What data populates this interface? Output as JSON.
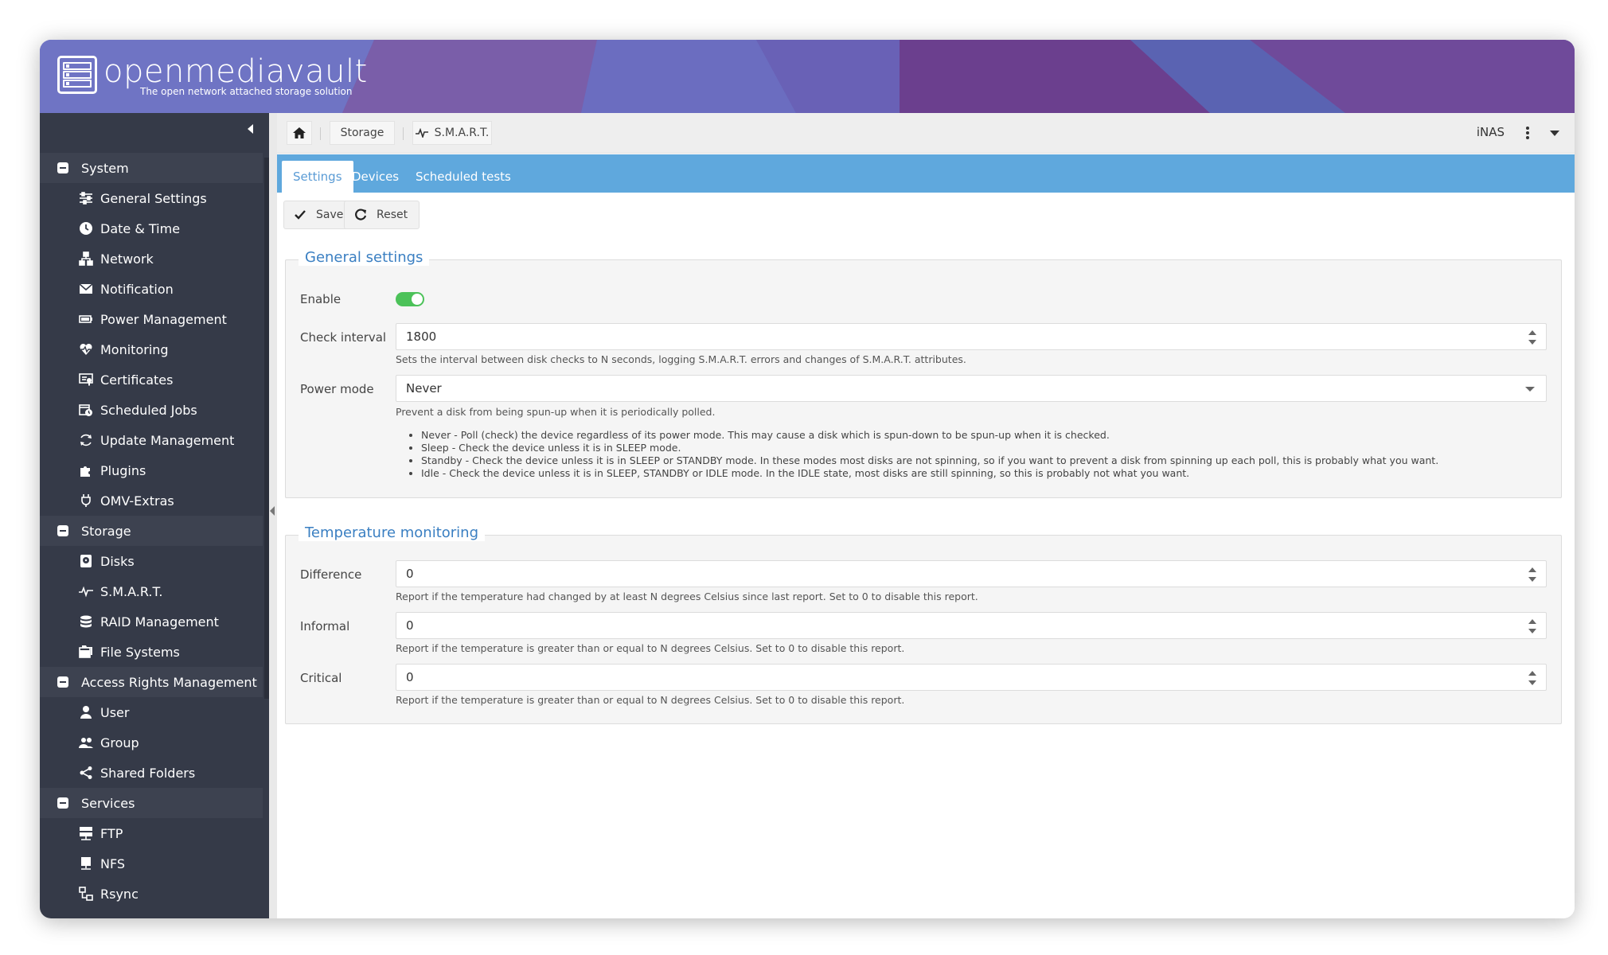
{
  "header": {
    "brand": "openmediavault",
    "tagline": "The open network attached storage solution"
  },
  "sidebar": {
    "groups": [
      {
        "label": "System",
        "items": [
          {
            "label": "General Settings",
            "icon": "sliders-icon"
          },
          {
            "label": "Date & Time",
            "icon": "clock-icon"
          },
          {
            "label": "Network",
            "icon": "network-icon"
          },
          {
            "label": "Notification",
            "icon": "mail-icon"
          },
          {
            "label": "Power Management",
            "icon": "battery-icon"
          },
          {
            "label": "Monitoring",
            "icon": "heart-pulse-icon"
          },
          {
            "label": "Certificates",
            "icon": "certificate-icon"
          },
          {
            "label": "Scheduled Jobs",
            "icon": "calendar-clock-icon"
          },
          {
            "label": "Update Management",
            "icon": "refresh-icon"
          },
          {
            "label": "Plugins",
            "icon": "puzzle-icon"
          },
          {
            "label": "OMV-Extras",
            "icon": "plug-icon"
          }
        ]
      },
      {
        "label": "Storage",
        "items": [
          {
            "label": "Disks",
            "icon": "disk-icon"
          },
          {
            "label": "S.M.A.R.T.",
            "icon": "pulse-icon"
          },
          {
            "label": "RAID Management",
            "icon": "database-icon"
          },
          {
            "label": "File Systems",
            "icon": "folders-icon"
          }
        ]
      },
      {
        "label": "Access Rights Management",
        "items": [
          {
            "label": "User",
            "icon": "user-icon"
          },
          {
            "label": "Group",
            "icon": "group-icon"
          },
          {
            "label": "Shared Folders",
            "icon": "share-icon"
          }
        ]
      },
      {
        "label": "Services",
        "items": [
          {
            "label": "FTP",
            "icon": "server-icon"
          },
          {
            "label": "NFS",
            "icon": "nfs-icon"
          },
          {
            "label": "Rsync",
            "icon": "sync-boxes-icon"
          }
        ]
      }
    ]
  },
  "breadcrumb": {
    "storage": "Storage",
    "current": "S.M.A.R.T."
  },
  "hostname": "iNAS",
  "tabs": {
    "settings": "Settings",
    "devices": "Devices",
    "scheduled": "Scheduled tests"
  },
  "toolbar": {
    "save": "Save",
    "reset": "Reset"
  },
  "general": {
    "legend": "General settings",
    "enable_label": "Enable",
    "interval_label": "Check interval",
    "interval_value": "1800",
    "interval_hint": "Sets the interval between disk checks to N seconds, logging S.M.A.R.T. errors and changes of S.M.A.R.T. attributes.",
    "power_label": "Power mode",
    "power_value": "Never",
    "power_hint": "Prevent a disk from being spun-up when it is periodically polled.",
    "modes": [
      "Never - Poll (check) the device regardless of its power mode. This may cause a disk which is spun-down to be spun-up when it is checked.",
      "Sleep - Check the device unless it is in SLEEP mode.",
      "Standby - Check the device unless it is in SLEEP or STANDBY mode. In these modes most disks are not spinning, so if you want to prevent a disk from spinning up each poll, this is probably what you want.",
      "Idle - Check the device unless it is in SLEEP, STANDBY or IDLE mode. In the IDLE state, most disks are still spinning, so this is probably not what you want."
    ]
  },
  "temperature": {
    "legend": "Temperature monitoring",
    "difference_label": "Difference",
    "difference_value": "0",
    "difference_hint": "Report if the temperature had changed by at least N degrees Celsius since last report. Set to 0 to disable this report.",
    "informal_label": "Informal",
    "informal_value": "0",
    "informal_hint": "Report if the temperature is greater than or equal to N degrees Celsius. Set to 0 to disable this report.",
    "critical_label": "Critical",
    "critical_value": "0",
    "critical_hint": "Report if the temperature is greater than or equal to N degrees Celsius. Set to 0 to disable this report."
  },
  "colors": {
    "accent": "#5fa8dd",
    "sidebar": "#353a48",
    "toggle_on": "#4cc259",
    "header": "#6a64b8"
  }
}
